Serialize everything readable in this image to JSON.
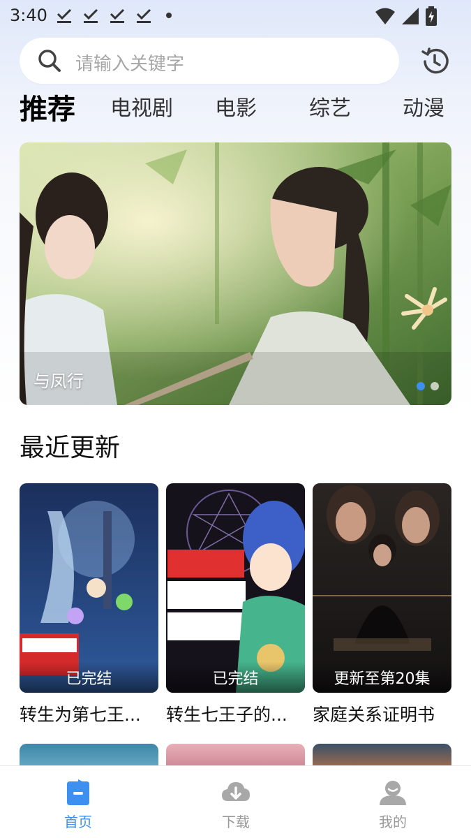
{
  "status_bar": {
    "time": "3:40"
  },
  "search": {
    "placeholder": "请输入关键字"
  },
  "tabs": [
    {
      "label": "推荐",
      "active": true
    },
    {
      "label": "电视剧",
      "active": false
    },
    {
      "label": "电影",
      "active": false
    },
    {
      "label": "综艺",
      "active": false
    },
    {
      "label": "动漫",
      "active": false
    }
  ],
  "banner": {
    "title": "与凤行",
    "page_count": 2,
    "active_page": 1
  },
  "recent": {
    "title": "最近更新",
    "items": [
      {
        "badge": "已完结",
        "title": "转生为第七王..."
      },
      {
        "badge": "已完结",
        "title": "转生七王子的..."
      },
      {
        "badge": "更新至第20集",
        "title": "家庭关系证明书"
      }
    ]
  },
  "bottom_nav": [
    {
      "label": "首页",
      "icon": "home-icon",
      "active": true
    },
    {
      "label": "下载",
      "icon": "download-icon",
      "active": false
    },
    {
      "label": "我的",
      "icon": "profile-icon",
      "active": false
    }
  ],
  "colors": {
    "accent": "#3d8ff0",
    "inactive": "#999999"
  }
}
